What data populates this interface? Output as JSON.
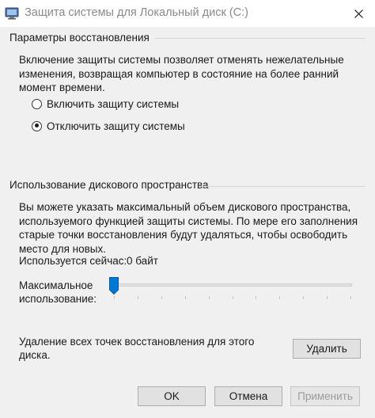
{
  "window": {
    "title": "Защита системы для Локальный диск (C:)",
    "close_glyph": "✕"
  },
  "restore": {
    "heading": "Параметры восстановления",
    "description": "Включение защиты системы позволяет отменять нежелательные изменения, возвращая компьютер в состояние на более ранний момент времени.",
    "options": [
      {
        "label": "Включить защиту системы",
        "selected": false
      },
      {
        "label": "Отключить защиту системы",
        "selected": true
      }
    ]
  },
  "disk": {
    "heading": "Использование дискового пространства",
    "description": "Вы можете указать максимальный объем дискового пространства, используемого функцией защиты системы. По мере его заполнения старые точки восстановления будут удаляться, чтобы освободить место для новых.",
    "current_usage_label": "Используется сейчас:",
    "current_usage_value": "0 байт",
    "max_usage_label_line1": "Максимальное",
    "max_usage_label_line2": "использование:",
    "slider_fraction": 0.0
  },
  "delete": {
    "text_line1": "Удаление всех точек восстановления для этого",
    "text_line2": "диска.",
    "button_label": "Удалить"
  },
  "footer": {
    "ok_label": "OK",
    "cancel_label": "Отмена",
    "apply_label": "Применить"
  },
  "colors": {
    "accent": "#0078d7",
    "background": "#f0f0f0",
    "disabled_text": "#9a9a9a"
  }
}
